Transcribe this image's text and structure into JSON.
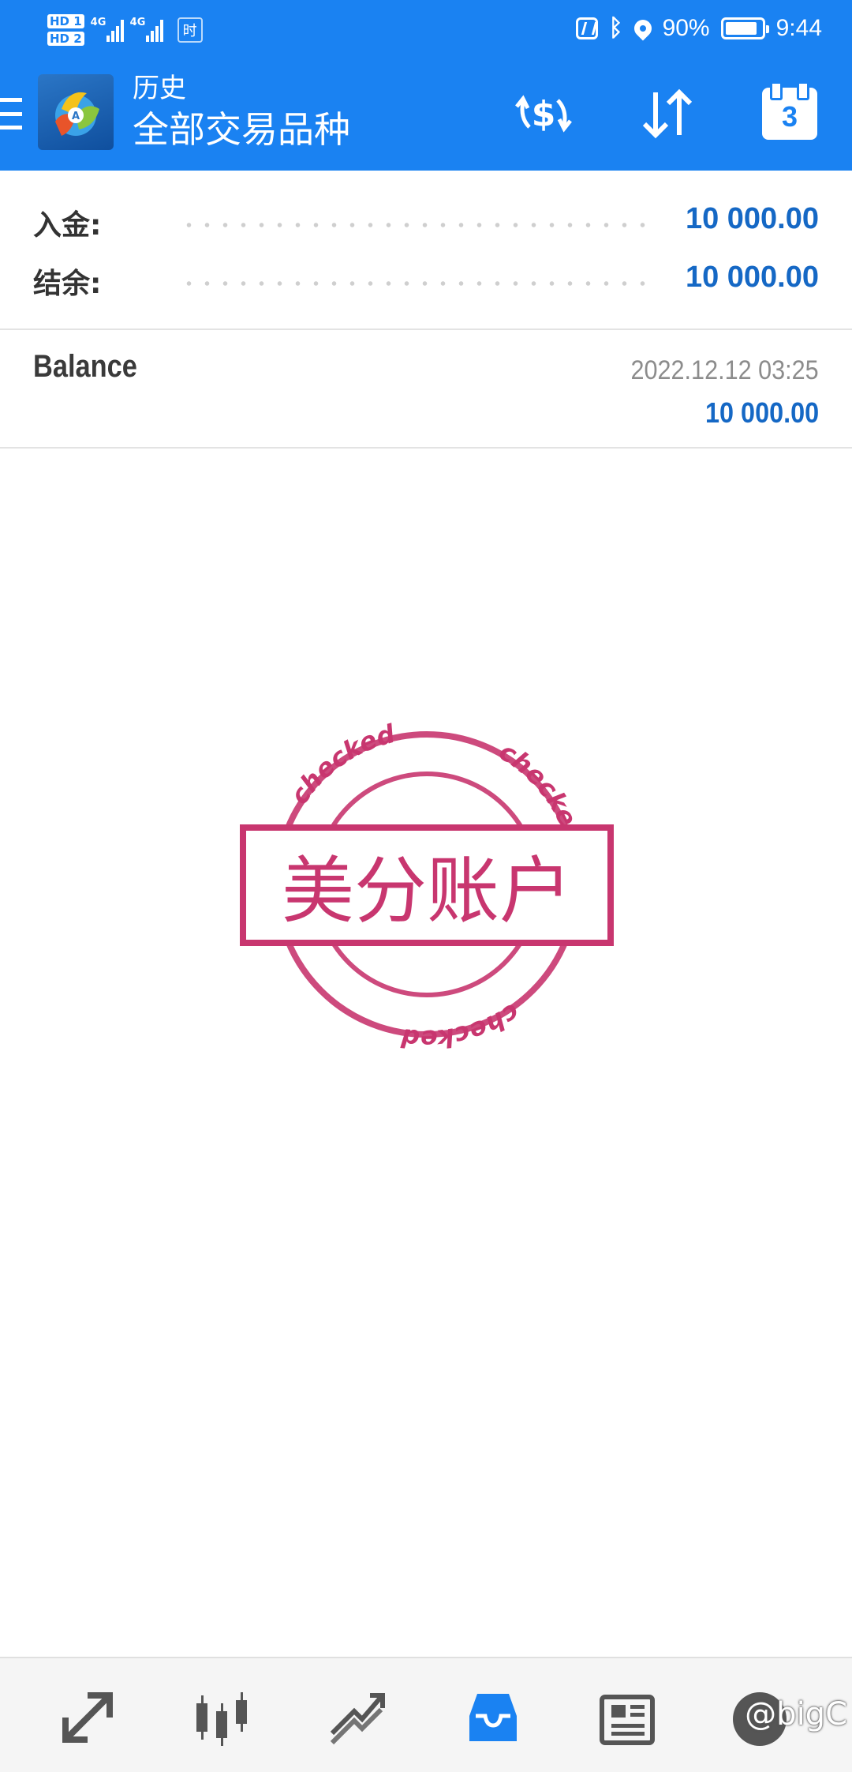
{
  "status_bar": {
    "sim1": "HD 1",
    "sim2": "HD 2",
    "network1": "4G",
    "network2": "4G",
    "extra": "时",
    "battery": "90%",
    "battery_level": 0.9,
    "time": "9:44",
    "icons": [
      "nfc-icon",
      "bluetooth-icon",
      "location-icon",
      "battery-icon"
    ]
  },
  "toolbar": {
    "title_top": "历史",
    "title_main": "全部交易品种",
    "calendar_badge": "3",
    "accent_color": "#1a82f2"
  },
  "summary": {
    "rows": [
      {
        "label": "入金:",
        "value": "10 000.00"
      },
      {
        "label": "结余:",
        "value": "10 000.00"
      }
    ]
  },
  "deal": {
    "type": "Balance",
    "time": "2022.12.12 03:25",
    "amount": "10 000.00"
  },
  "stamp": {
    "text": "美分账户",
    "ring_text": "checked",
    "color": "#c8366f"
  },
  "bottom_nav": {
    "items": [
      "quotes",
      "charts",
      "trade",
      "history",
      "news",
      "settings"
    ],
    "active": "history",
    "watermark": "@bigC"
  }
}
